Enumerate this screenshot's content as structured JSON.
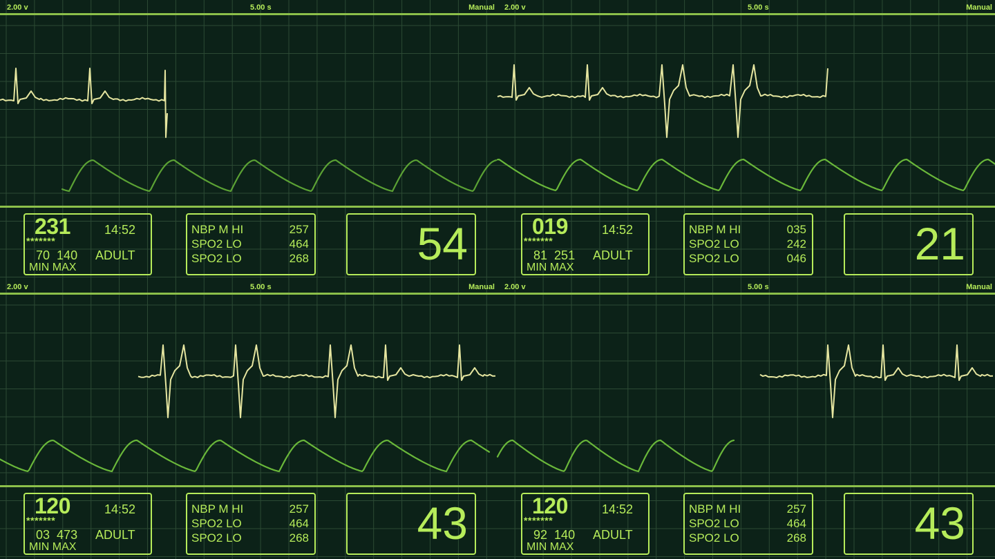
{
  "theme": {
    "background": "#0c2218",
    "grid": "#2c4a34",
    "accent": "#b6ec5a",
    "divider": "#8cc04a",
    "ecg_trace": "#e6e6a0",
    "pleth_trace": "#6ab83a"
  },
  "panes": [
    {
      "header": {
        "scale": "2.00 v",
        "sweep": "5.00 s",
        "mode": "Manual"
      },
      "vitals": {
        "value": "231",
        "time": "14:52",
        "stars": "*******",
        "min": "70",
        "max": "140",
        "patient": "ADULT",
        "minmax_label": "MIN MAX"
      },
      "alarms": [
        {
          "label": "NBP M HI",
          "value": "257"
        },
        {
          "label": "SPO2 LO",
          "value": "464"
        },
        {
          "label": "SPO2 LO",
          "value": "268"
        }
      ],
      "rate": "54"
    },
    {
      "header": {
        "scale": "2.00 v",
        "sweep": "5.00 s",
        "mode": "Manual"
      },
      "vitals": {
        "value": "019",
        "time": "14:52",
        "stars": "*******",
        "min": "81",
        "max": "251",
        "patient": "ADULT",
        "minmax_label": "MIN MAX"
      },
      "alarms": [
        {
          "label": "NBP M HI",
          "value": "035"
        },
        {
          "label": "SPO2 LO",
          "value": "242"
        },
        {
          "label": "SPO2 LO",
          "value": "046"
        }
      ],
      "rate": "21"
    },
    {
      "header": {
        "scale": "2.00 v",
        "sweep": "5.00 s",
        "mode": "Manual"
      },
      "vitals": {
        "value": "120",
        "time": "14:52",
        "stars": "*******",
        "min": "03",
        "max": "473",
        "patient": "ADULT",
        "minmax_label": "MIN MAX"
      },
      "alarms": [
        {
          "label": "NBP M HI",
          "value": "257"
        },
        {
          "label": "SPO2 LO",
          "value": "464"
        },
        {
          "label": "SPO2 LO",
          "value": "268"
        }
      ],
      "rate": "43"
    },
    {
      "header": {
        "scale": "2.00 v",
        "sweep": "5.00 s",
        "mode": "Manual"
      },
      "vitals": {
        "value": "120",
        "time": "14:52",
        "stars": "*******",
        "min": "92",
        "max": "140",
        "patient": "ADULT",
        "minmax_label": "MIN MAX"
      },
      "alarms": [
        {
          "label": "NBP M HI",
          "value": "257"
        },
        {
          "label": "SPO2 LO",
          "value": "464"
        },
        {
          "label": "SPO2 LO",
          "value": "268"
        }
      ],
      "rate": "43"
    }
  ]
}
